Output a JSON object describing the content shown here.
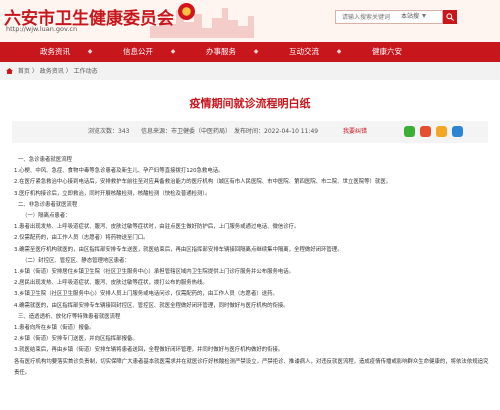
{
  "header": {
    "site_title": "六安市卫生健康委员会",
    "site_url": "http://wjw.luan.gov.cn",
    "search_placeholder": "请输入搜索关键词",
    "search_scope": "本站搜"
  },
  "nav": {
    "items": [
      "政务资讯",
      "信息公开",
      "办事服务",
      "互动交流",
      "健康六安"
    ]
  },
  "breadcrumb": {
    "items": [
      "首页",
      "政务资讯",
      "工作动态"
    ],
    "separator": "〉"
  },
  "article": {
    "title": "疫情期间就诊流程明白纸",
    "views_label": "浏览次数：",
    "views": "343",
    "source_label": "信息来源：",
    "source": "市卫健委（中医药局）",
    "time_label": "发布时间：",
    "time": "2022-04-10 11:49",
    "print_label": "我要纠错",
    "share_colors": [
      "#3cb034",
      "#e64e2e",
      "#f5a623",
      "#2c84d4"
    ],
    "paragraphs": [
      {
        "text": "一、急诊患者就医流程",
        "indent": 1
      },
      {
        "text": "1.心梗、中风、急症、食物中毒等急诊患者及新生儿、孕产妇等直接拨打120急救电话。",
        "indent": 0
      },
      {
        "text": "2.在医疗紧急救治中心接到电话后，安排救护车前往至对应具备救治能力的医疗机构（城区有市人民医院、市中医院、第四医院、市二院、世立医院等）就医。",
        "indent": 0
      },
      {
        "text": "3.医疗机构接诊后，立即救治，同时开展核酸检测，核酸检测（快检及普通检测）。",
        "indent": 0
      },
      {
        "text": "二、非急诊患者就医流程",
        "indent": 1
      },
      {
        "text": "（一）隔离点患者：",
        "indent": 2
      },
      {
        "text": "1.患者出现发热、上呼吸道症状、腹泻、皮肤过敏等症状时，由驻点医生做好防护后，上门服务或通过电话、微信诊疗。",
        "indent": 0
      },
      {
        "text": "2.仅需配药的，由工作人员（志愿者）将药物送至门口。",
        "indent": 0
      },
      {
        "text": "3.确需至医疗机构就医的，由区指挥部安排专车送医，就医结束后，再由区指挥部安排车辆接回隔离点继续集中隔离，全程做好闭环管理。",
        "indent": 0
      },
      {
        "text": "（二）封控区、管控区、静态管理地区患者：",
        "indent": 2
      },
      {
        "text": "1.乡镇（街道）安排居住乡镇卫生院（社区卫生服务中心）承担管辖区域内卫生院提供上门诊疗服务并公布服务电话。",
        "indent": 0
      },
      {
        "text": "2.居民出现发热、上呼吸道症状、腹泻、皮肤过敏等症状，拨打公布的服务热线。",
        "indent": 0
      },
      {
        "text": "3.乡镇卫生院（社区卫生服务中心）安排人员上门服务或电话问诊，仅需配药的，由工作人员（志愿者）送药。",
        "indent": 0
      },
      {
        "text": "4.确需就医的，由区指挥部安排专车辆接回封控区、管控区、就医全程做好闭环管理，同时做好与医疗机构的衔接。",
        "indent": 0
      },
      {
        "text": "三、造透透析、放化疗等特殊患者就医流程",
        "indent": 1
      },
      {
        "text": "1.患者向所在乡镇（街道）报备。",
        "indent": 0
      },
      {
        "text": "2.乡镇（街道）安排专门送医，并向区指挥部报备。",
        "indent": 0
      },
      {
        "text": "3.就医结束后，再由乡镇（街道）安排车辆将患者送回，全程做好闭环管理，并同时做好与医疗机构做好的衔接。",
        "indent": 0
      },
      {
        "text": "各有医疗机构均要落实首诊负责制，切实保障广大患者基本就医需求并在就医诊疗好核酸检测严禁设立，严禁拒诊、推诿病人，对违反就医流程，造成疫情传播或影响群众生命健康的，将依法依规追究责任。",
        "indent": 0,
        "wrap": true
      }
    ]
  }
}
